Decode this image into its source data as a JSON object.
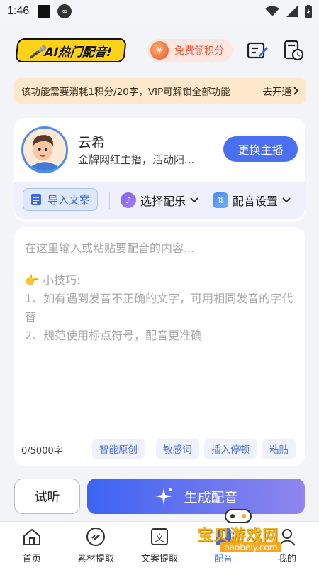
{
  "status_bar": {
    "time": "1:46"
  },
  "header": {
    "logo_text": "🎤AI热门配音!",
    "points_label": "免费领积分"
  },
  "notice": {
    "text": "该功能需要消耗1积分/20字，VIP可解锁全部功能",
    "action": "去开通"
  },
  "host": {
    "name": "云希",
    "desc": "金牌网红主播，活动阳...",
    "change_label": "更换主播"
  },
  "tools": {
    "import_label": "导入文案",
    "music_label": "选择配乐",
    "settings_label": "配音设置"
  },
  "editor": {
    "placeholder": "在这里输入或粘贴要配音的内容...",
    "tips_title": "👉 小技巧:",
    "tip1": "1、如有遇到发音不正确的文字，可用相同发音的字代替",
    "tip2": "2、规范使用标点符号，配音更准确",
    "counter": "0/5000字",
    "chips": [
      "智能原创",
      "敏感词",
      "插入停顿",
      "粘贴"
    ]
  },
  "actions": {
    "listen_label": "试听",
    "generate_label": "生成配音"
  },
  "tabs": [
    {
      "label": "首页",
      "icon": "home-icon"
    },
    {
      "label": "素材提取",
      "icon": "link-icon"
    },
    {
      "label": "文案提取",
      "icon": "text-doc-icon"
    },
    {
      "label": "配音",
      "icon": "mic-icon"
    },
    {
      "label": "我的",
      "icon": "user-icon"
    }
  ],
  "watermark": {
    "title": "宝贝游戏网",
    "url": "baobeiy.com"
  },
  "colors": {
    "accent": "#4a6ff0",
    "notice_bg": "#fde8cc",
    "points_text": "#ea5a3b"
  }
}
